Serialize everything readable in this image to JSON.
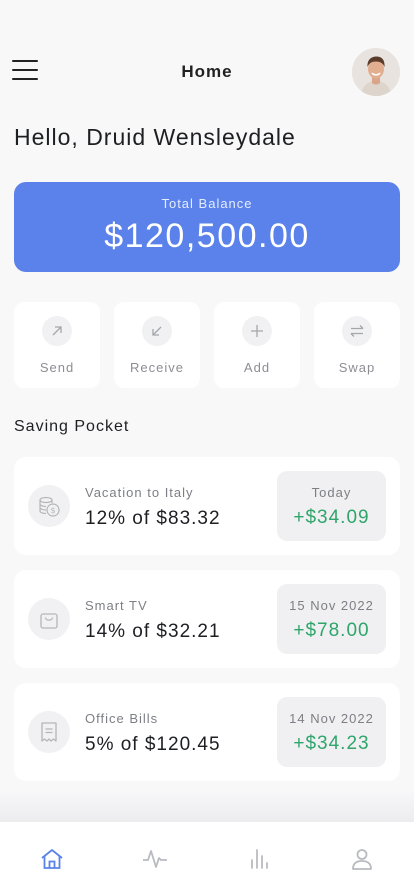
{
  "header": {
    "title": "Home"
  },
  "greeting": "Hello, Druid Wensleydale",
  "balance": {
    "label": "Total Balance",
    "value": "$120,500.00"
  },
  "actions": [
    {
      "label": "Send",
      "icon": "arrow-up-right-icon"
    },
    {
      "label": "Receive",
      "icon": "arrow-down-left-icon"
    },
    {
      "label": "Add",
      "icon": "plus-icon"
    },
    {
      "label": "Swap",
      "icon": "swap-icon"
    }
  ],
  "saving_pocket": {
    "title": "Saving Pocket",
    "items": [
      {
        "name": "Vacation to Italy",
        "amount": "12% of $83.32",
        "date": "Today",
        "gain": "+$34.09",
        "icon": "coins-icon"
      },
      {
        "name": "Smart TV",
        "amount": "14% of $32.21",
        "date": "15 Nov 2022",
        "gain": "+$78.00",
        "icon": "shopping-bag-icon"
      },
      {
        "name": "Office Bills",
        "amount": "5% of $120.45",
        "date": "14 Nov 2022",
        "gain": "+$34.23",
        "icon": "receipt-icon"
      }
    ]
  },
  "bottom_nav": [
    {
      "icon": "home-icon",
      "active": true
    },
    {
      "icon": "activity-icon",
      "active": false
    },
    {
      "icon": "bar-chart-icon",
      "active": false
    },
    {
      "icon": "user-icon",
      "active": false
    }
  ],
  "colors": {
    "accent": "#5b82ea",
    "gain": "#2fa56b",
    "nav_active": "#5b82ea",
    "nav_inactive": "#b9bbc1"
  }
}
